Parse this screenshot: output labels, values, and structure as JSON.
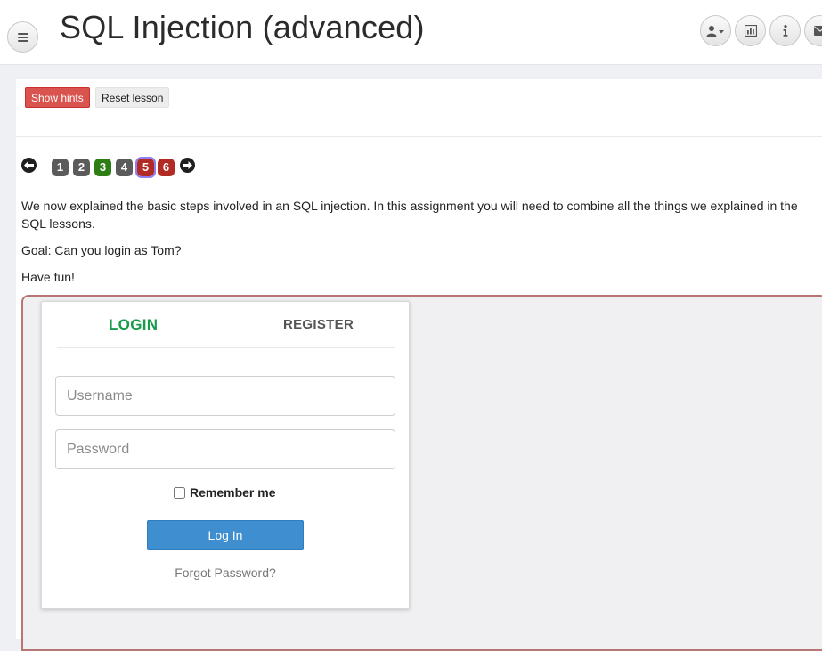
{
  "header": {
    "title": "SQL Injection (advanced)",
    "menu_icon": "hamburger-icon",
    "buttons": [
      "user-dropdown-icon",
      "bar-chart-icon",
      "info-icon",
      "envelope-icon"
    ]
  },
  "toolbar": {
    "show_hints_label": "Show hints",
    "reset_lesson_label": "Reset lesson"
  },
  "pagination": {
    "prev_icon": "arrow-left-icon",
    "next_icon": "arrow-right-icon",
    "pages": [
      {
        "label": "1",
        "state": "gray"
      },
      {
        "label": "2",
        "state": "gray"
      },
      {
        "label": "3",
        "state": "green"
      },
      {
        "label": "4",
        "state": "gray"
      },
      {
        "label": "5",
        "state": "red-current"
      },
      {
        "label": "6",
        "state": "red"
      }
    ]
  },
  "lesson": {
    "paragraph1": "We now explained the basic steps involved in an SQL injection. In this assignment you will need to combine all the things we explained in the SQL lessons.",
    "paragraph2": "Goal: Can you login as Tom?",
    "paragraph3": "Have fun!"
  },
  "login_form": {
    "tab_login": "LOGIN",
    "tab_register": "REGISTER",
    "username_placeholder": "Username",
    "username_value": "",
    "password_placeholder": "Password",
    "password_value": "",
    "remember_label": "Remember me",
    "remember_checked": false,
    "submit_label": "Log In",
    "forgot_label": "Forgot Password?"
  },
  "colors": {
    "hints_button": "#d9534f",
    "login_tab": "#1a9a4a",
    "login_button": "#3e8ed0",
    "page_completed": "#2d7e14",
    "page_failed": "#b12a24",
    "current_outline": "#8e7ef0",
    "attack_border": "#b87575"
  }
}
